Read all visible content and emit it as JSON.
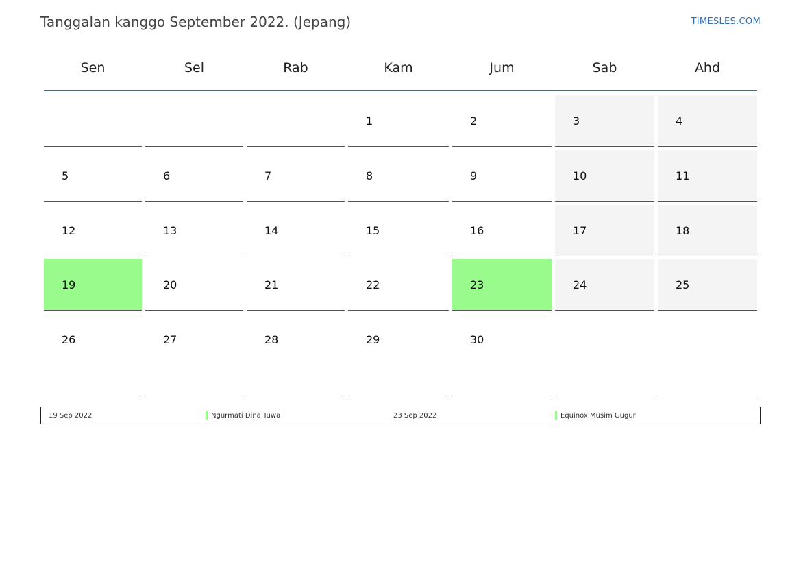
{
  "header": {
    "title": "Tanggalan kanggo September 2022. (Jepang)",
    "site": "TIMESLES.COM"
  },
  "weekdays": [
    "Sen",
    "Sel",
    "Rab",
    "Kam",
    "Jum",
    "Sab",
    "Ahd"
  ],
  "weeks": [
    [
      "",
      "",
      "",
      "1",
      "2",
      "3",
      "4"
    ],
    [
      "5",
      "6",
      "7",
      "8",
      "9",
      "10",
      "11"
    ],
    [
      "12",
      "13",
      "14",
      "15",
      "16",
      "17",
      "18"
    ],
    [
      "19",
      "20",
      "21",
      "22",
      "23",
      "24",
      "25"
    ],
    [
      "26",
      "27",
      "28",
      "29",
      "30",
      "",
      ""
    ]
  ],
  "holidays": [
    "19",
    "23"
  ],
  "colors": {
    "holiday": "#98fb8c",
    "weekend": "#f4f4f4",
    "header_rule": "#4a6785",
    "link": "#2f6fb0"
  },
  "legend": [
    {
      "date": "19 Sep 2022",
      "name": "Ngurmati Dina Tuwa"
    },
    {
      "date": "23 Sep 2022",
      "name": "Equinox Musim Gugur"
    }
  ]
}
